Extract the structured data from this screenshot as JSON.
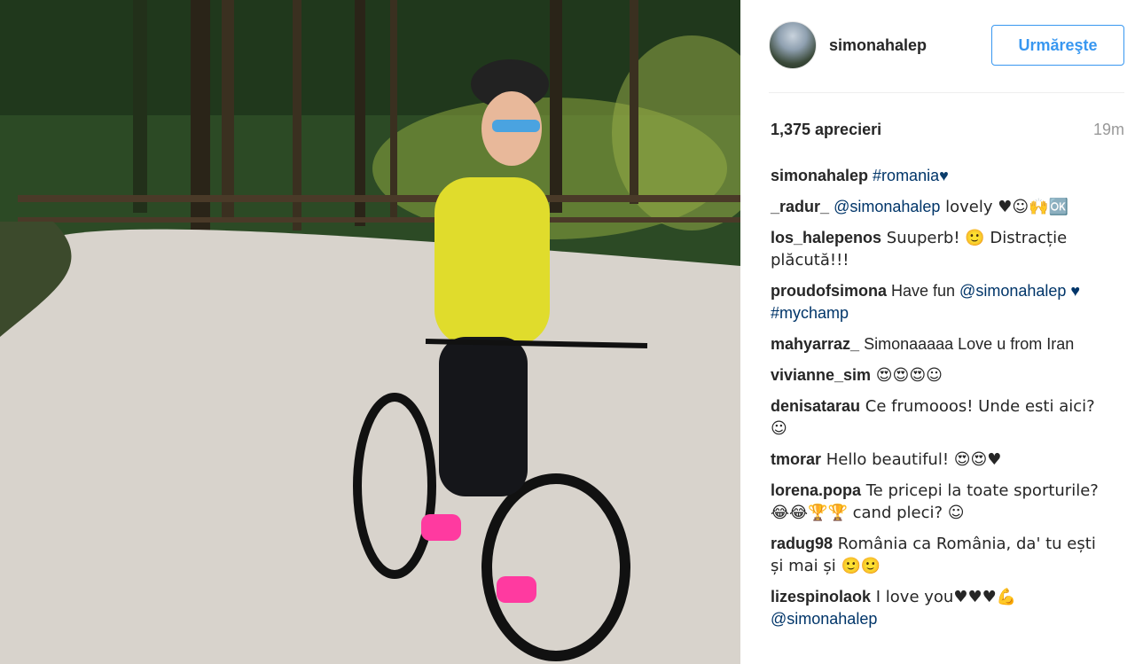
{
  "post": {
    "username": "simonahalep",
    "follow_label": "Urmăreşte",
    "likes": "1,375 aprecieri",
    "time": "19m"
  },
  "comments": [
    {
      "user": "simonahalep",
      "text": "",
      "link": "#romania",
      "after": "♥"
    },
    {
      "user": "_radur_",
      "link": "@simonahalep",
      "text": " lovely ♥☺🙌🆗"
    },
    {
      "user": "los_halepenos",
      "text": " Suuperb! 🙂 Distracție plăcută!!!"
    },
    {
      "user": "proudofsimona",
      "text": " Have fun ",
      "link": "@simonahalep",
      "after": " ♥ #mychamp"
    },
    {
      "user": "mahyarraz_",
      "text": " Simonaaaaa Love u from Iran"
    },
    {
      "user": "vivianne_sim",
      "text": " 😍😍😍☺"
    },
    {
      "user": "denisatarau",
      "text": " Ce frumooos! Unde esti aici?☺"
    },
    {
      "user": "tmorar",
      "text": " Hello beautiful! 😍😍♥"
    },
    {
      "user": "lorena.popa",
      "text": " Te pricepi la toate sporturile? 😂😂🏆🏆 cand pleci? ☺"
    },
    {
      "user": "radug98",
      "text": " România ca România, da' tu ești și mai și 🙂🙂"
    },
    {
      "user": "lizespinolaok",
      "text": " I love you♥♥♥💪",
      "link": "@simonahalep"
    }
  ]
}
